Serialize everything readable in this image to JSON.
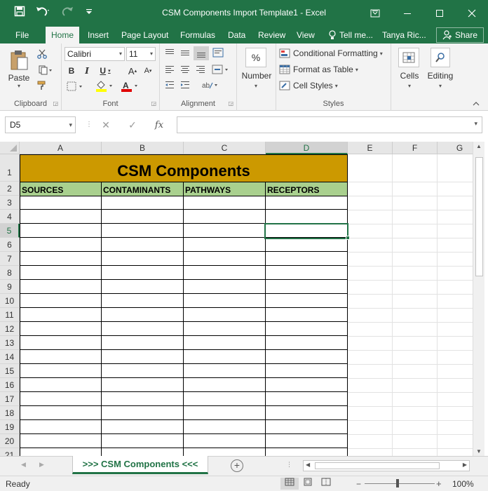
{
  "window": {
    "title": "CSM Components Import Template1  -  Excel",
    "minimize": "—",
    "restore": "☐",
    "close": "✕",
    "ribbon_display": "▣"
  },
  "qat": {
    "save_icon": "save-icon",
    "undo_icon": "undo-icon",
    "redo_icon": "redo-icon"
  },
  "tabs": [
    "File",
    "Home",
    "Insert",
    "Page Layout",
    "Formulas",
    "Data",
    "Review",
    "View"
  ],
  "tell_me": "Tell me...",
  "user": "Tanya Ric...",
  "share": "Share",
  "ribbon": {
    "clipboard": {
      "label": "Clipboard",
      "paste": "Paste"
    },
    "font": {
      "label": "Font",
      "name": "Calibri",
      "size": "11"
    },
    "alignment": {
      "label": "Alignment"
    },
    "number": {
      "label": "Number",
      "percent": "%"
    },
    "styles": {
      "label": "Styles",
      "conditional": "Conditional Formatting",
      "format_table": "Format as Table",
      "cell_styles": "Cell Styles"
    },
    "cells": {
      "label": "Cells"
    },
    "editing": {
      "label": "Editing"
    }
  },
  "formula_bar": {
    "name_box": "D5",
    "value": ""
  },
  "columns": [
    "A",
    "B",
    "C",
    "D",
    "E",
    "F",
    "G"
  ],
  "selected_column": "D",
  "rows": [
    "1",
    "2",
    "3",
    "4",
    "5",
    "6",
    "7",
    "8",
    "9",
    "10",
    "11",
    "12",
    "13",
    "14",
    "15",
    "16",
    "17",
    "18",
    "19",
    "20",
    "21"
  ],
  "selected_row": "5",
  "sheet": {
    "title": "CSM Components",
    "headers": [
      "SOURCES",
      "CONTAMINANTS",
      "PATHWAYS",
      "RECEPTORS"
    ]
  },
  "sheet_tab": ">>> CSM Components <<<",
  "status": {
    "ready": "Ready",
    "zoom": "100%"
  },
  "colors": {
    "accent": "#217346",
    "title_fill": "#cc9900",
    "header_fill": "#a9d08e"
  }
}
